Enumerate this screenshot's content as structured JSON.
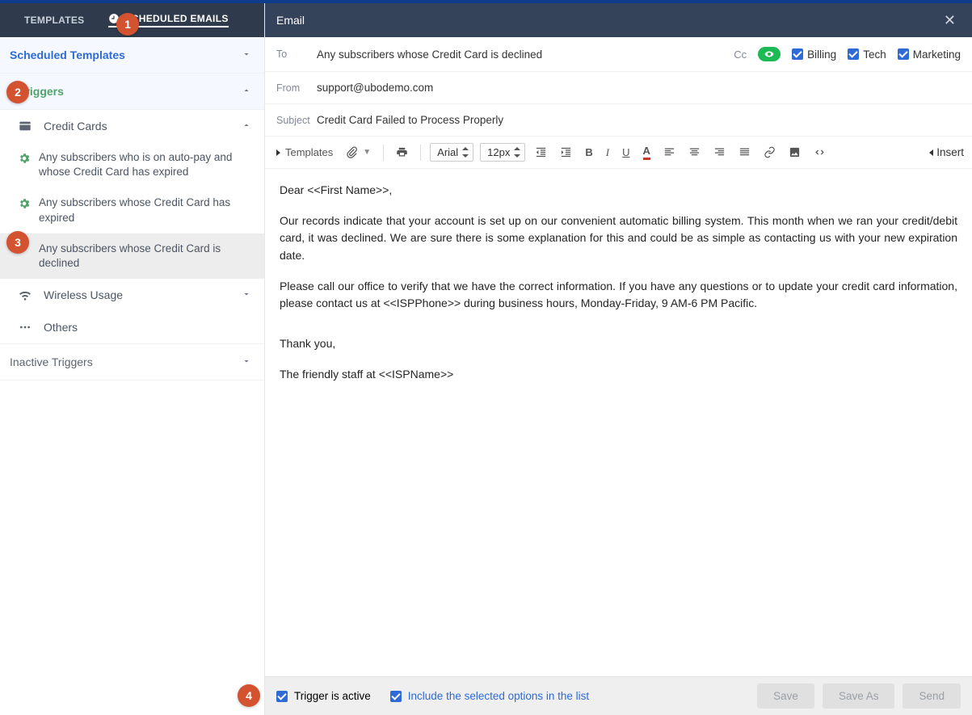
{
  "badges": {
    "b1": "1",
    "b2": "2",
    "b3": "3",
    "b4": "4"
  },
  "sidebar": {
    "tabs": {
      "templates": "TEMPLATES",
      "scheduled": "SCHEDULED EMAILS"
    },
    "sections": {
      "scheduled_templates": "Scheduled Templates",
      "active_triggers": "e Triggers",
      "credit_cards": "Credit Cards",
      "wireless_usage": "Wireless Usage",
      "others": "Others",
      "inactive_triggers": "Inactive Triggers"
    },
    "triggers": [
      "Any subscribers who is on auto-pay and whose Credit Card has expired",
      "Any subscribers whose Credit Card has expired",
      "Any subscribers whose Credit Card is declined"
    ]
  },
  "header": {
    "title": "Email"
  },
  "form": {
    "to_label": "To",
    "to_value": "Any subscribers whose Credit Card is declined",
    "cc_label": "Cc",
    "tags": {
      "billing": "Billing",
      "tech": "Tech",
      "marketing": "Marketing"
    },
    "from_label": "From",
    "from_value": "support@ubodemo.com",
    "subject_label": "Subject",
    "subject_value": "Credit Card Failed to Process Properly"
  },
  "toolbar": {
    "templates": "Templates",
    "font_family": "Arial",
    "font_size": "12px",
    "insert": "Insert"
  },
  "body": {
    "p1": "Dear <<First Name>>,",
    "p2": "Our records indicate that your account is set up on our convenient automatic billing system. This month when we ran your credit/debit card, it was declined. We are sure there is some explanation for this and could be as simple as contacting us with your new expiration date.",
    "p3": "Please call our office to verify that we have the correct information. If you have any questions or to update your credit card information, please contact us at <<ISPPhone>> during business hours, Monday-Friday, 9 AM-6 PM Pacific.",
    "p4": "Thank you,",
    "p5": "The friendly staff at <<ISPName>>"
  },
  "footer": {
    "trigger_active": "Trigger is active",
    "include_selected": "Include the selected options in the list",
    "save": "Save",
    "save_as": "Save As",
    "send": "Send"
  }
}
